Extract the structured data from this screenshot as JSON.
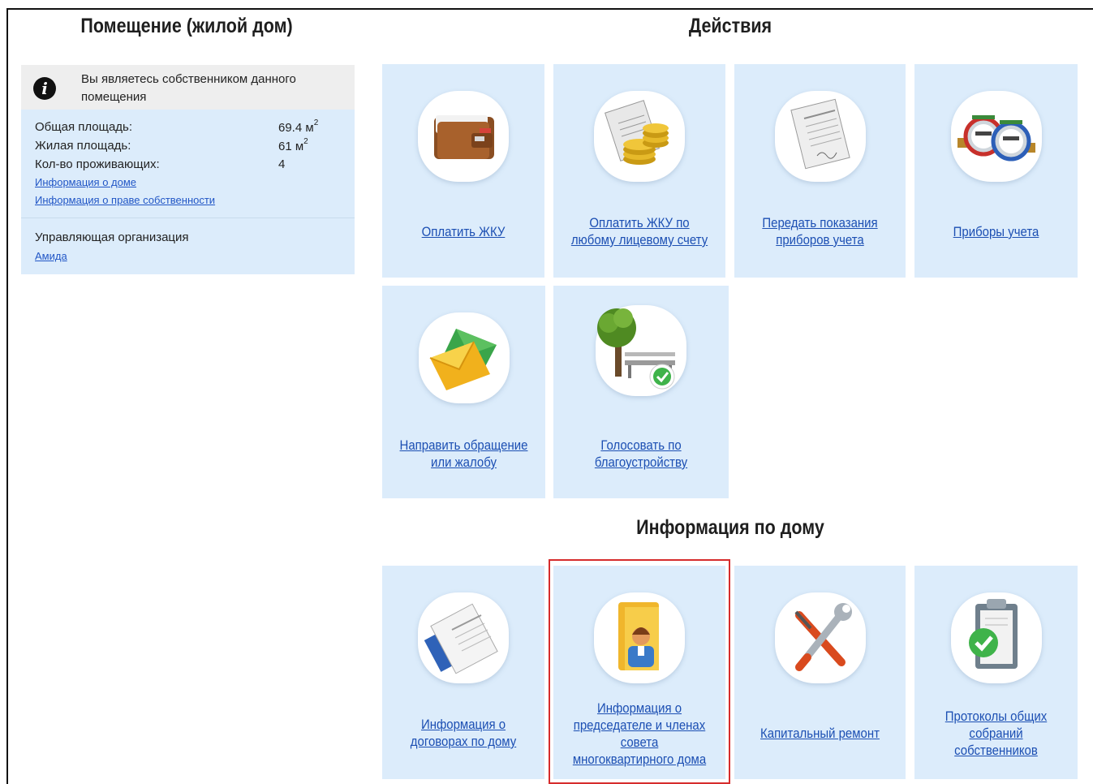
{
  "left": {
    "title": "Помещение (жилой дом)",
    "notice": "Вы являетесь собственником данного помещения",
    "properties": [
      {
        "label": "Общая площадь:",
        "value": "69.4 м",
        "sup": "2"
      },
      {
        "label": "Жилая площадь:",
        "value": "61 м",
        "sup": "2"
      },
      {
        "label": "Кол-во проживающих:",
        "value": "4",
        "sup": ""
      }
    ],
    "link_house": "Информация о доме",
    "link_ownership": "Информация о праве собственности",
    "management_label": "Управляющая организация",
    "management_link": "Амида"
  },
  "actions": {
    "title": "Действия",
    "tiles": [
      {
        "label": "Оплатить ЖКУ",
        "icon": "wallet-icon"
      },
      {
        "label": "Оплатить ЖКУ по любому лицевому счету",
        "icon": "coins-invoice-icon"
      },
      {
        "label": "Передать показания приборов учета",
        "icon": "readings-sheet-icon"
      },
      {
        "label": "Приборы учета",
        "icon": "water-meter-icon"
      },
      {
        "label": "Направить обращение или жалобу",
        "icon": "envelope-icon"
      },
      {
        "label": "Голосовать по благоустройству",
        "icon": "tree-bench-icon"
      }
    ]
  },
  "info": {
    "title": "Информация по дому",
    "tiles": [
      {
        "label": "Информация о договорах по дому",
        "icon": "contract-documents-icon"
      },
      {
        "label": "Информация о председателе и членах совета многоквартирного дома",
        "icon": "person-folder-icon"
      },
      {
        "label": "Капитальный ремонт",
        "icon": "wrench-screwdriver-icon"
      },
      {
        "label": "Протоколы общих собраний собственников",
        "icon": "clipboard-check-icon"
      }
    ]
  },
  "colors": {
    "tile_bg": "#dcecfb",
    "link": "#1c4fb3",
    "selection": "#d62c2c"
  }
}
